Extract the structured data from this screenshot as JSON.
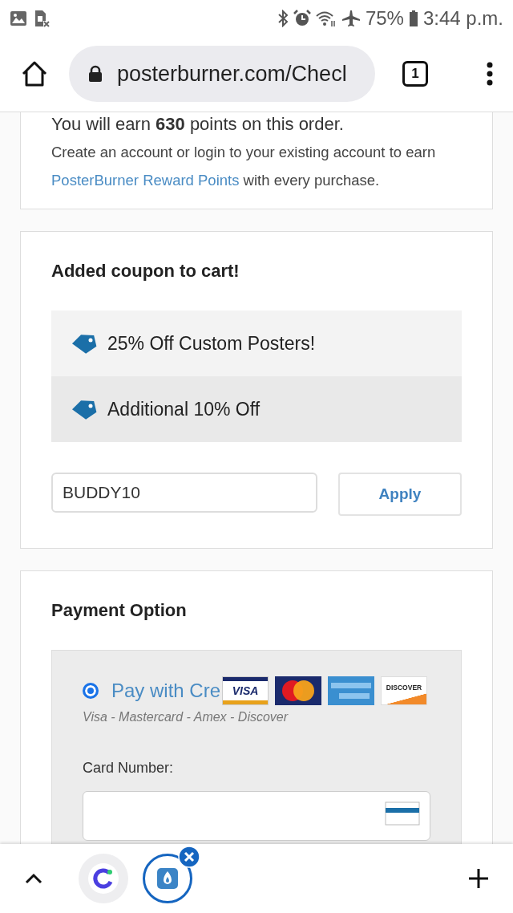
{
  "status_bar": {
    "battery": "75%",
    "time": "3:44 p.m."
  },
  "browser": {
    "url": "posterburner.com/Checl",
    "tab_count": "1"
  },
  "rewards": {
    "earn_text": "You will earn **630** points on this order.",
    "text_before": "Create an account or login to your existing account to earn ",
    "link": "PosterBurner Reward Points",
    "text_after": " with every purchase."
  },
  "coupons": {
    "title": "Added coupon to cart!",
    "items": [
      {
        "label": "25% Off Custom Posters!"
      },
      {
        "label": "Additional 10% Off"
      }
    ],
    "code": "BUDDY10",
    "apply_button": "Apply"
  },
  "payment": {
    "title": "Payment Option",
    "option": {
      "label": "Pay with Cre",
      "selected": true,
      "subtitle": "Visa - Mastercard - Amex - Discover"
    },
    "cards": [
      {
        "kind": "visa",
        "label": "VISA"
      },
      {
        "kind": "mastercard"
      },
      {
        "kind": "amex"
      },
      {
        "kind": "discover",
        "label": "DISCOVER"
      }
    ],
    "card_number_label": "Card Number:"
  },
  "bottom_tabs": [
    {
      "kind": "ring-app",
      "selected": false
    },
    {
      "kind": "flame-app",
      "selected": true
    }
  ]
}
